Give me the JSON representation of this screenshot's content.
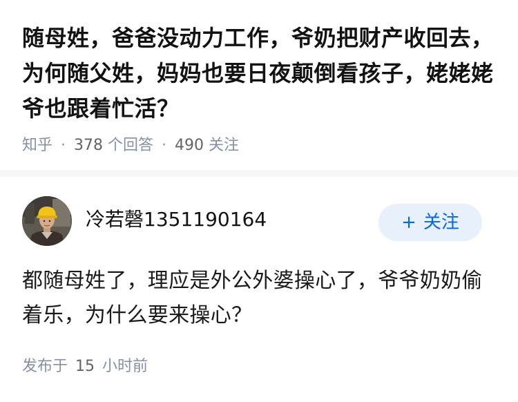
{
  "question": {
    "title": "随母姓，爸爸没动力工作，爷奶把财产收回去，为何随父姓，妈妈也要日夜颠倒看孩子，姥姥姥爷也跟着忙活？",
    "source": "知乎",
    "separator": "·",
    "answer_count": "378",
    "answer_count_label": "个回答",
    "follower_count": "490",
    "follower_label": "关注"
  },
  "answer": {
    "author_name": "冷若磬1351190164",
    "follow_icon": "plus-icon",
    "follow_symbol": "+",
    "follow_label": "关注",
    "content": "都随母姓了，理应是外公外婆操心了，爷爷奶奶偷着乐，为什么要来操心？",
    "time_prefix": "发布于",
    "time_value": "15",
    "time_suffix": "小时前"
  },
  "colors": {
    "text_primary": "#121212",
    "text_meta": "#8590a6",
    "accent": "#0066ff",
    "follow_bg": "#e8f1fb",
    "divider": "#f6f6f6"
  }
}
